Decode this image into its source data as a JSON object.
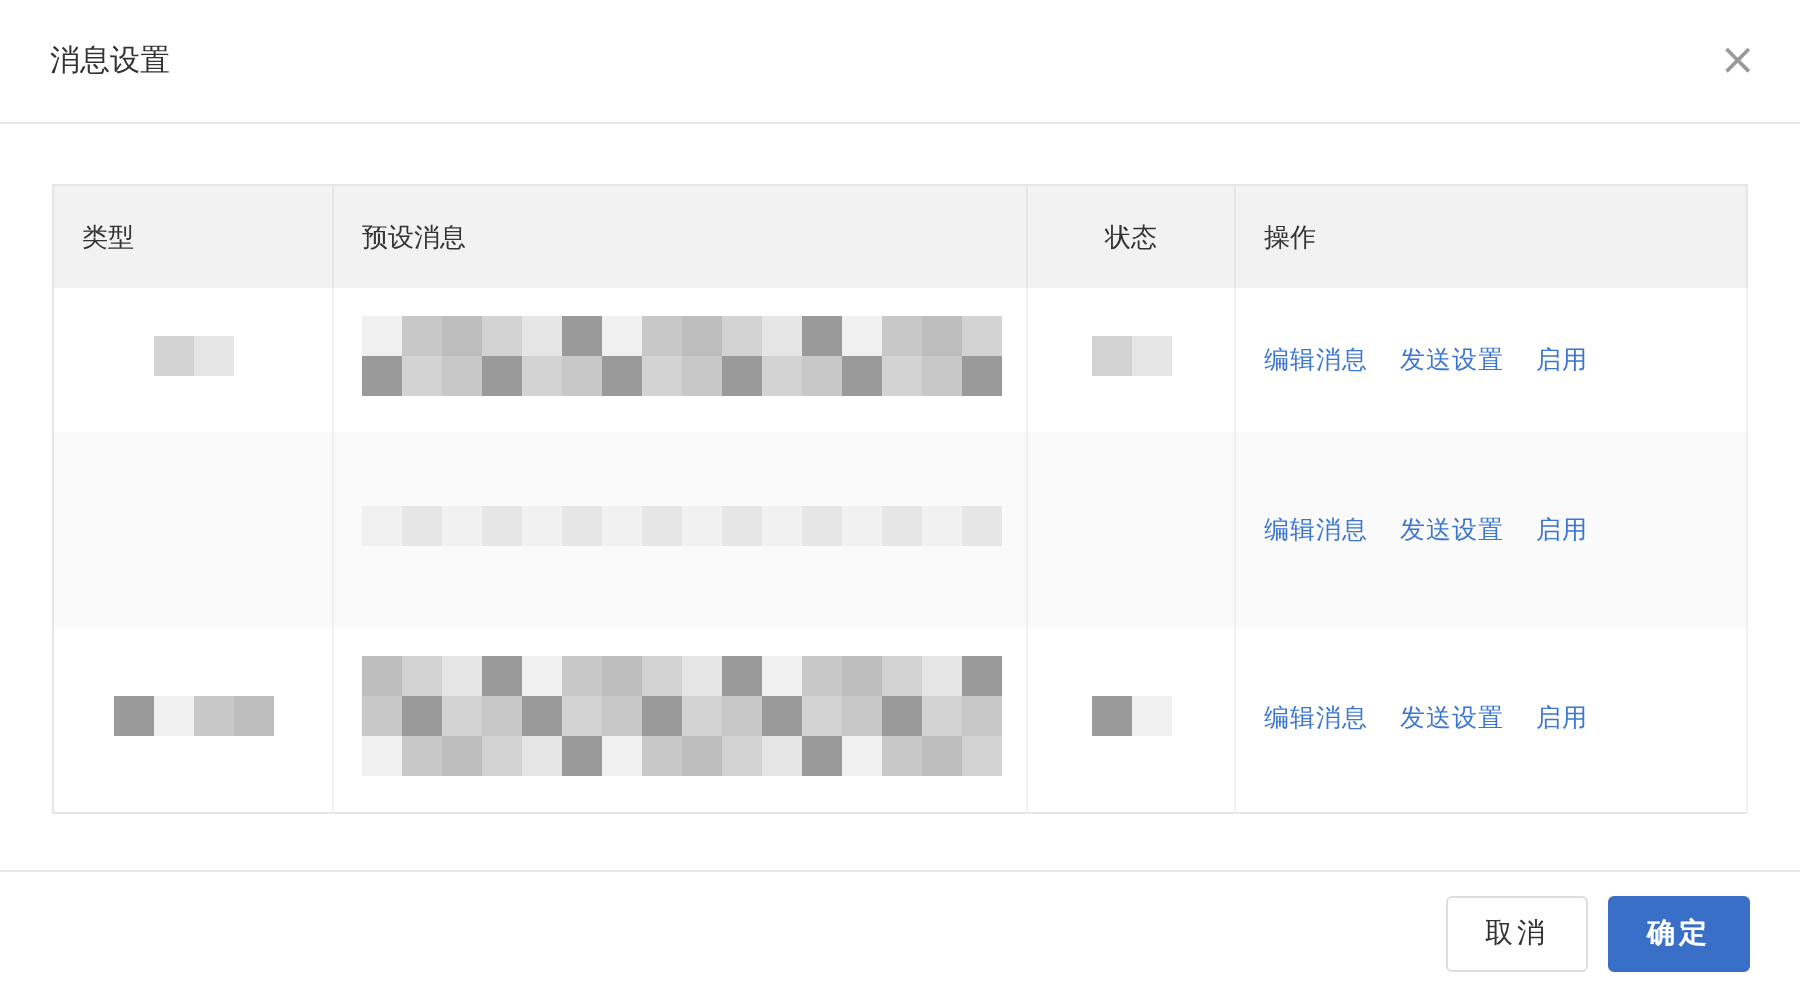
{
  "dialog": {
    "title": "消息设置",
    "close": "×"
  },
  "table": {
    "columns": [
      "类型",
      "预设消息",
      "状态",
      "操作"
    ],
    "rows": [
      {
        "highlighted": false,
        "actions": [
          "编辑消息",
          "发送设置",
          "启用"
        ]
      },
      {
        "highlighted": true,
        "actions": [
          "编辑消息",
          "发送设置",
          "启用"
        ]
      },
      {
        "highlighted": false,
        "actions": [
          "编辑消息",
          "发送设置",
          "启用"
        ]
      }
    ]
  },
  "buttons": [
    {
      "label": "取消",
      "kind": "secondary"
    },
    {
      "label": "确定",
      "kind": "primary"
    }
  ]
}
